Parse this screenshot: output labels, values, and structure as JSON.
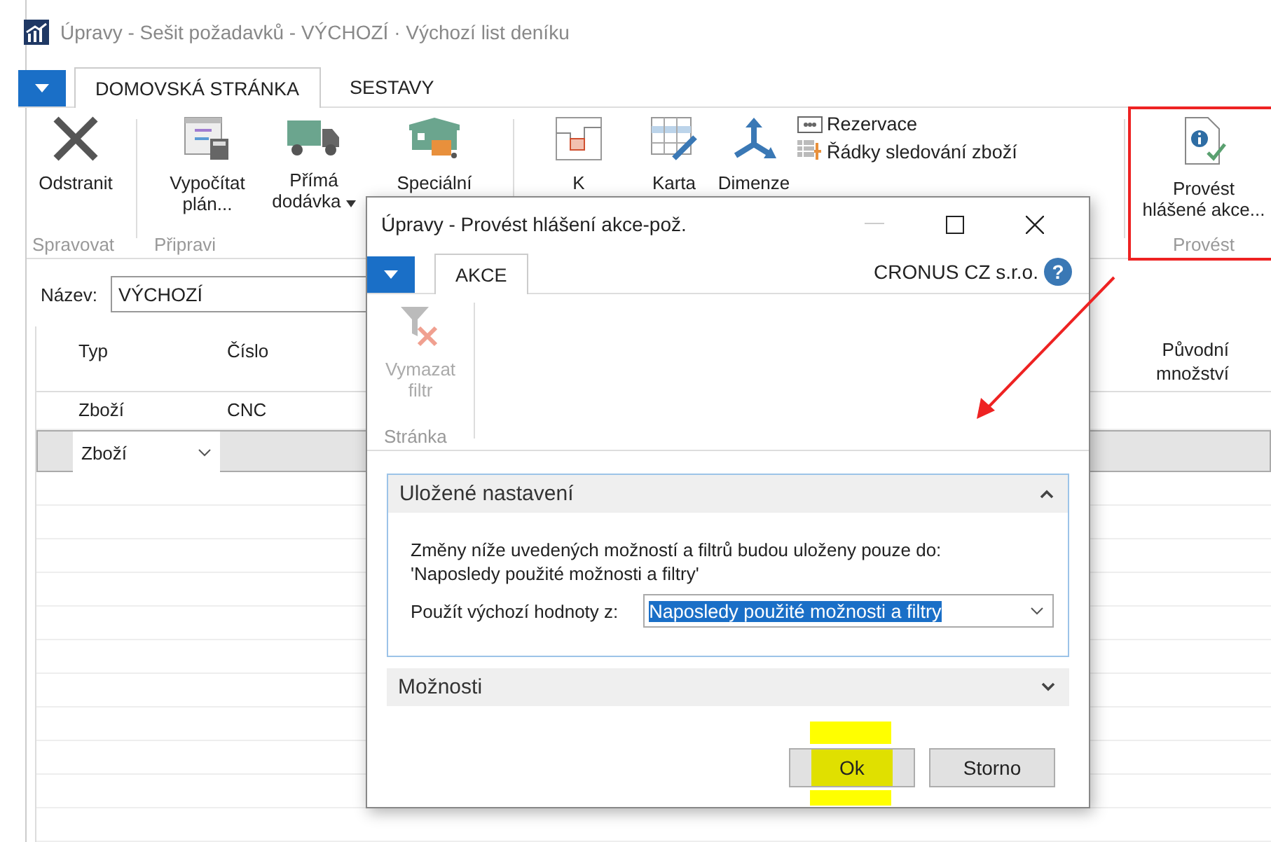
{
  "window": {
    "title": "Úpravy - Sešit požadavků - VÝCHOZÍ · Výchozí list deníku"
  },
  "tabs": [
    {
      "label": "DOMOVSKÁ STRÁNKA",
      "selected": true
    },
    {
      "label": "SESTAVY",
      "selected": false
    }
  ],
  "ribbon": {
    "delete": "Odstranit",
    "manage_group": "Spravovat",
    "calc": "Vypočítat plán...",
    "drop": "Přímá dodávka",
    "special": "Speciální",
    "prepare_group": "Připravi",
    "k": "K",
    "card": "Karta",
    "dimensions": "Dimenze",
    "reservation": "Rezervace",
    "tracking": "Řádky sledování zboží",
    "carry_out": "Provést\nhlášené akce...",
    "carry_group": "Provést"
  },
  "name_field": {
    "label": "Název:",
    "value": "VÝCHOZÍ"
  },
  "table": {
    "columns": [
      "Typ",
      "Číslo",
      "Původní množství"
    ],
    "rows": [
      {
        "cells": [
          "Zboží",
          "CNC"
        ],
        "selected": false
      },
      {
        "cells": [
          "Zboží"
        ],
        "selected": true
      }
    ]
  },
  "dialog": {
    "title": "Úpravy - Provést hlášení akce-pož.",
    "tabs": [
      {
        "label": "AKCE",
        "selected": true
      }
    ],
    "company": "CRONUS CZ s.r.o.",
    "help": "?",
    "action": {
      "label": "Vymazat filtr",
      "disabled": true
    },
    "action_group": "Stránka",
    "sections": [
      {
        "title": "Uložené nastavení",
        "expanded": true,
        "note": "Změny níže uvedených možností a filtrů budou uloženy pouze do:\n'Naposledy použité možnosti a filtry'",
        "field_label": "Použít výchozí hodnoty z:",
        "field_value": "Naposledy použité možnosti a filtry"
      },
      {
        "title": "Možnosti",
        "expanded": false
      }
    ],
    "buttons": [
      "Ok",
      "Storno"
    ]
  }
}
